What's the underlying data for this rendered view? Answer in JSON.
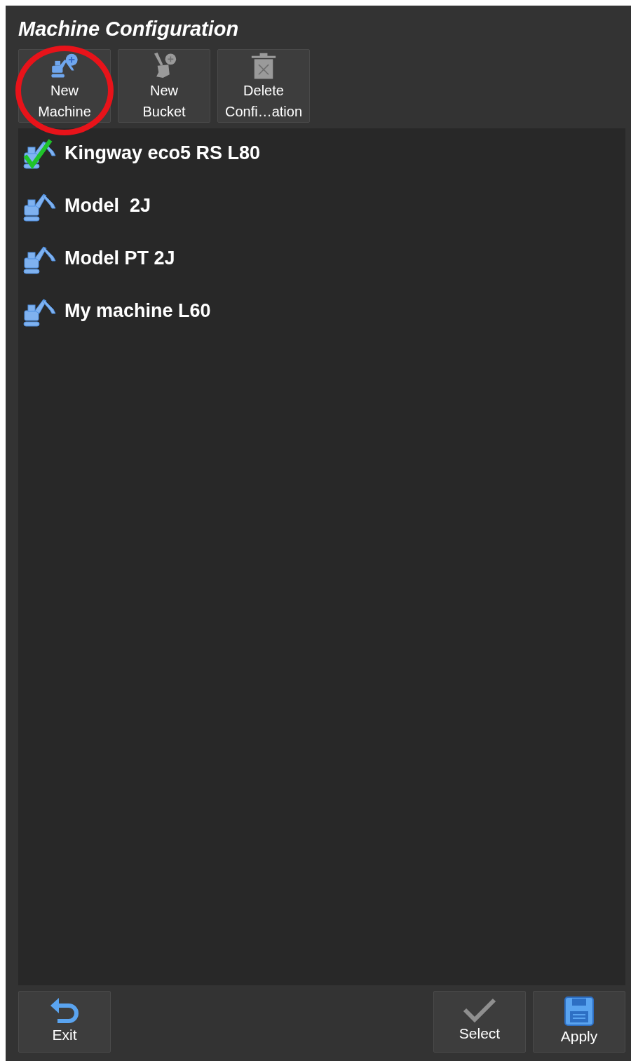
{
  "title": "Machine Configuration",
  "toolbar": [
    {
      "kind": "machine",
      "label": "New\nMachine",
      "highlighted": true
    },
    {
      "kind": "bucket",
      "label": "New\nBucket",
      "highlighted": false
    },
    {
      "kind": "delete",
      "label": "Delete\nConfi…ation",
      "highlighted": false
    }
  ],
  "machines": [
    {
      "name": "Kingway eco5 RS L80",
      "checked": true
    },
    {
      "name": "Model  2J",
      "checked": false
    },
    {
      "name": "Model PT 2J",
      "checked": false
    },
    {
      "name": "My machine L60",
      "checked": false
    }
  ],
  "footer_left": [
    {
      "kind": "exit",
      "label": "Exit"
    }
  ],
  "footer_right": [
    {
      "kind": "select",
      "label": "Select"
    },
    {
      "kind": "apply",
      "label": "Apply"
    }
  ]
}
